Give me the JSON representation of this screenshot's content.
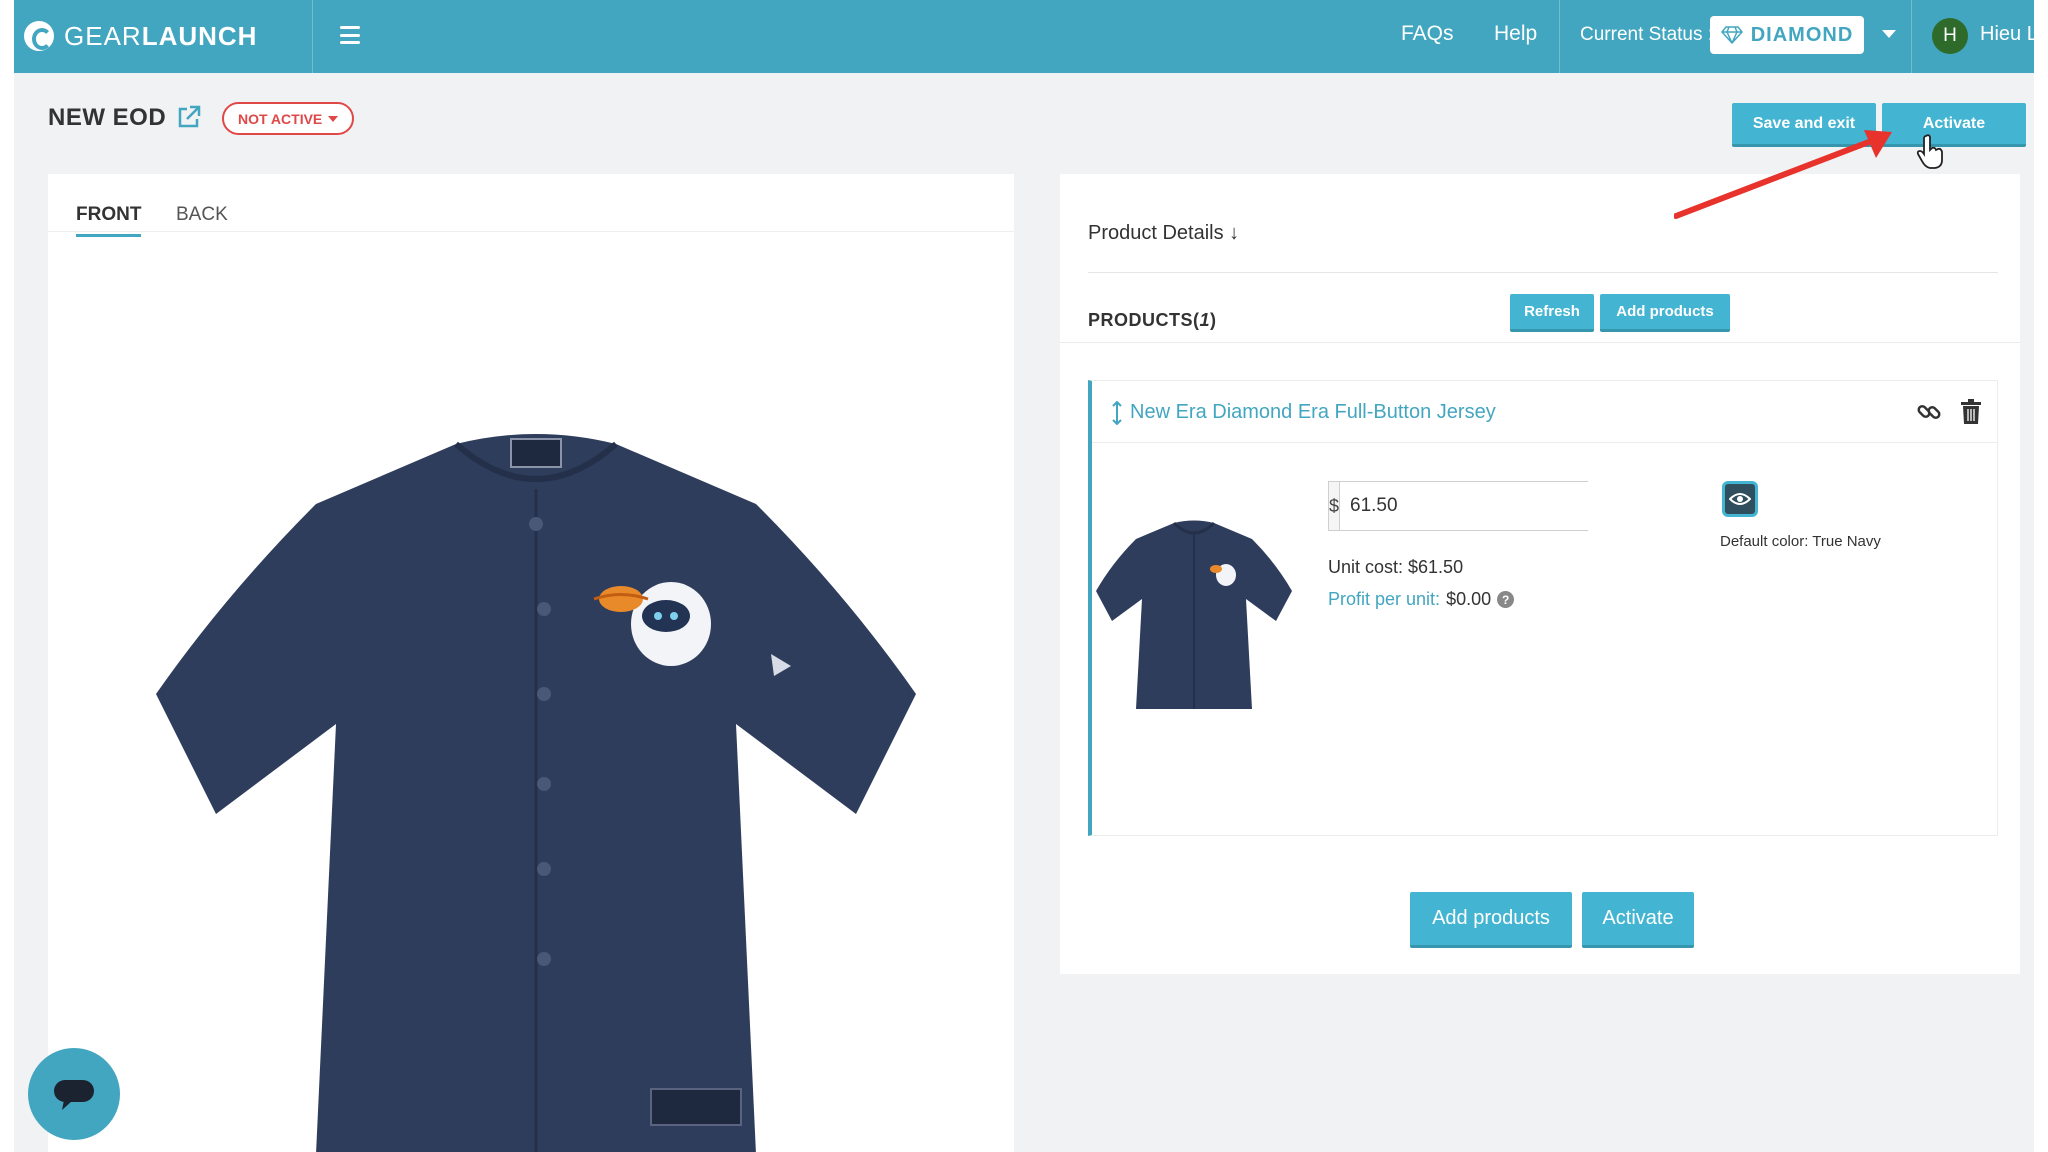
{
  "app": {
    "logo_light": "GEAR",
    "logo_bold": "LAUNCH",
    "accent_color": "#43a6c0",
    "danger_color": "#e04848"
  },
  "topbar": {
    "faqs": "FAQs",
    "help": "Help",
    "status_label": "Current Status :",
    "status_value": "DIAMOND",
    "avatar_initial": "H",
    "user_name": "Hieu L"
  },
  "header": {
    "title": "NEW EOD",
    "status_pill": "NOT ACTIVE",
    "save_label": "Save and exit",
    "activate_label": "Activate"
  },
  "preview": {
    "tabs": [
      {
        "label": "FRONT",
        "active": true
      },
      {
        "label": "BACK",
        "active": false
      }
    ]
  },
  "details": {
    "section_title": "Product Details ↓",
    "products_label": "PRODUCTS(",
    "products_count": "1",
    "products_close": ")",
    "refresh_label": "Refresh",
    "add_products_label": "Add products"
  },
  "product": {
    "name": "New Era Diamond Era Full-Button Jersey",
    "currency": "$",
    "price": "61.50",
    "unit_cost": "Unit cost: $61.50",
    "profit_label": "Profit per unit:",
    "profit_value": "$0.00",
    "default_color": "Default color: True Navy"
  },
  "footer_actions": {
    "add_products_label": "Add products",
    "activate_label": "Activate"
  }
}
